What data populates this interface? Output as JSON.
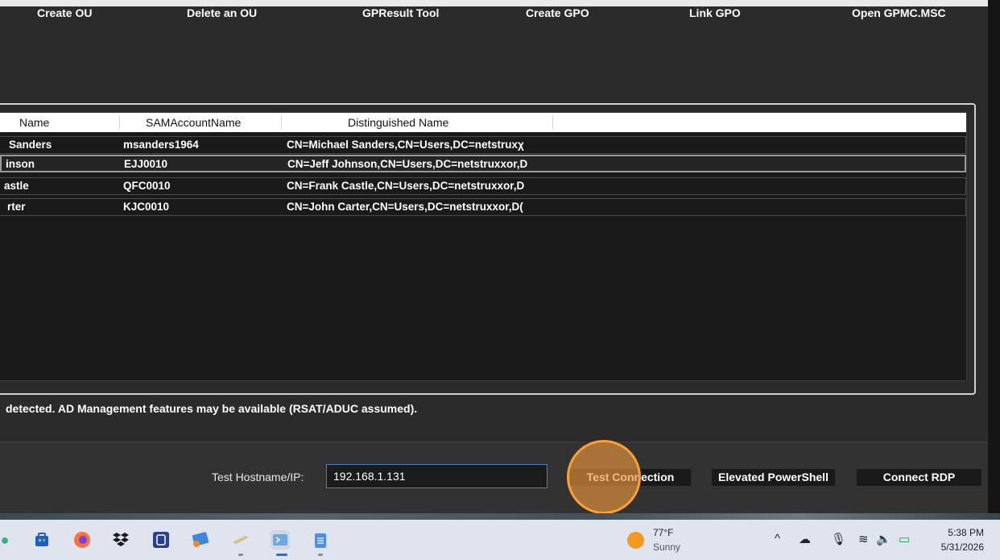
{
  "toolbar": {
    "create_ou": "Create OU",
    "delete_ou": "Delete an OU",
    "gpresult": "GPResult Tool",
    "create_gpo": "Create GPO",
    "link_gpo": "Link GPO",
    "open_gpmc": "Open GPMC.MSC"
  },
  "table": {
    "columns": [
      "Name",
      "SAMAccountName",
      "Distinguished Name"
    ],
    "rows": [
      {
        "name": "Sanders",
        "sam": "msanders1964",
        "dn": "CN=Michael Sanders,CN=Users,DC=netstruxχ"
      },
      {
        "name": "inson",
        "sam": "EJJ0010",
        "dn": "CN=Jeff Johnson,CN=Users,DC=netstruxxor,D"
      },
      {
        "name": "astle",
        "sam": "QFC0010",
        "dn": "CN=Frank Castle,CN=Users,DC=netstruxxor,D"
      },
      {
        "name": "rter",
        "sam": "KJC0010",
        "dn": "CN=John Carter,CN=Users,DC=netstruxxor,D("
      }
    ],
    "selected_index": 1
  },
  "status": {
    "text": "detected. AD Management features may be available (RSAT/ADUC assumed)."
  },
  "connection": {
    "label": "Test Hostname/IP:",
    "host_value": "192.168.1.131",
    "test_button": "Test Connection",
    "powershell_button": "Elevated PowerShell",
    "rdp_button": "Connect RDP"
  },
  "taskbar": {
    "weather_temp": "77°F",
    "weather_desc": "Sunny",
    "time": "5:38 PM",
    "date": "5/31/2026"
  },
  "colors": {
    "app_bg": "#2b2b2b",
    "accent_border": "#4c7fb6",
    "click_highlight": "#ff9f33"
  }
}
